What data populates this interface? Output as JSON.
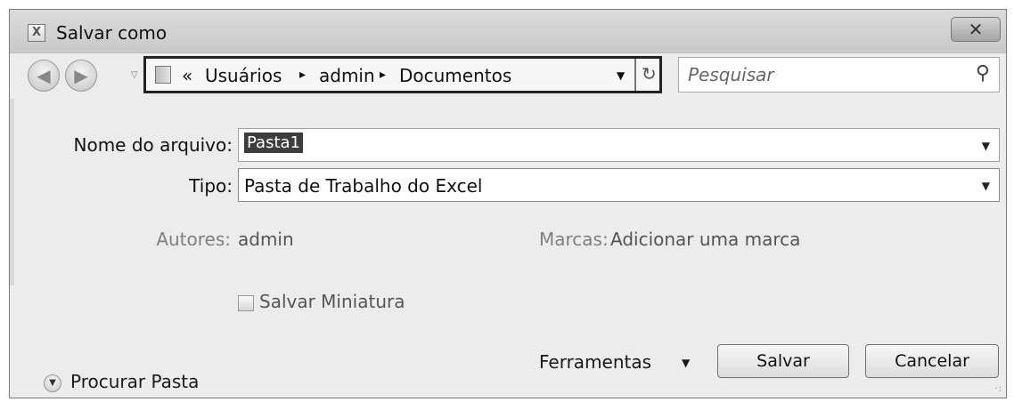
{
  "window": {
    "title": "Salvar como"
  },
  "addressbar": {
    "lead": "«",
    "crumbs": [
      "Usuários",
      "admin",
      "Documentos"
    ],
    "separator": "▸"
  },
  "search": {
    "placeholder": "Pesquisar"
  },
  "form": {
    "filename_label": "Nome do arquivo:",
    "filename_value": "Pasta1",
    "type_label": "Tipo:",
    "type_value": "Pasta de Trabalho do Excel",
    "authors_label": "Autores:",
    "authors_value": "admin",
    "tags_label": "Marcas:",
    "tags_value": "Adicionar uma marca",
    "thumbnail_label": "Salvar Miniatura",
    "thumbnail_checked": false
  },
  "footer": {
    "browse_label": "Procurar Pasta",
    "tools_label": "Ferramentas",
    "save_label": "Salvar",
    "cancel_label": "Cancelar"
  },
  "icons": {
    "app": "excel-icon",
    "close": "close-icon",
    "back": "back-arrow-icon",
    "forward": "forward-arrow-icon",
    "folder": "folder-icon",
    "refresh": "refresh-icon",
    "search": "search-icon",
    "expand": "chevron-down-circle-icon"
  }
}
